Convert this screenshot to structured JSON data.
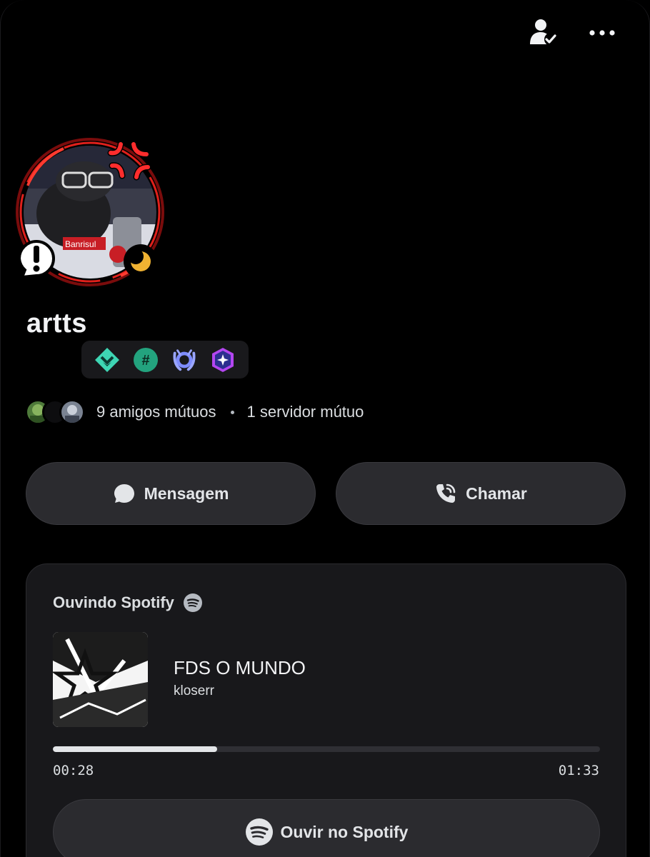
{
  "profile": {
    "username": "artts",
    "status": "idle",
    "accent_color": "#e0201b"
  },
  "header": {
    "icons": [
      "friend-check-icon",
      "more-options-icon"
    ]
  },
  "badges": [
    "hypesquad-balance-icon",
    "active-developer-icon",
    "early-supporter-laurel-icon",
    "quest-badge-icon"
  ],
  "mutuals": {
    "friends_text": "9 amigos mútuos",
    "servers_text": "1 servidor mútuo"
  },
  "actions": {
    "message_label": "Mensagem",
    "call_label": "Chamar"
  },
  "activity": {
    "header": "Ouvindo Spotify",
    "track_title": "FDS O MUNDO",
    "artist": "kloserr",
    "elapsed": "00:28",
    "duration": "01:33",
    "progress_fraction": 0.3,
    "button_label": "Ouvir no Spotify"
  },
  "colors": {
    "background": "#000000",
    "card": "#18181b",
    "button": "#2b2b2f",
    "idle_moon": "#f0b232"
  }
}
